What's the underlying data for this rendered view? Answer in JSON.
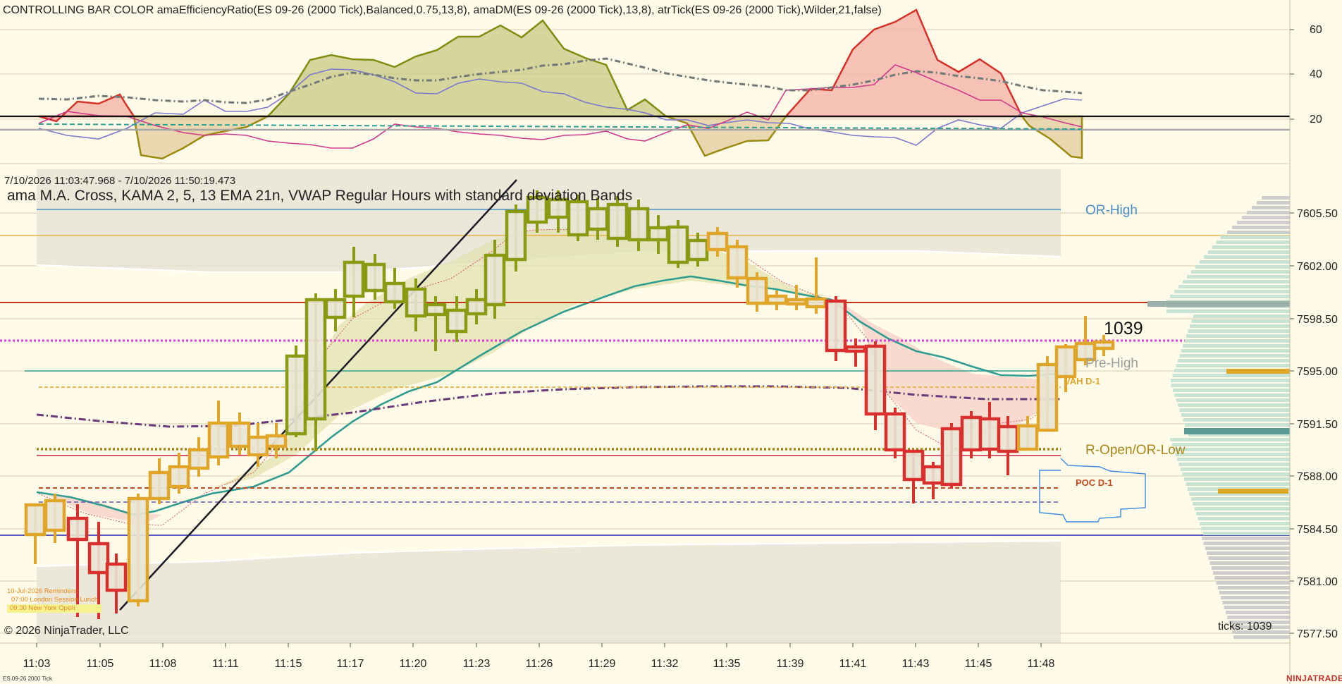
{
  "header": {
    "indicator_title": "CONTROLLING BAR COLOR amaEfficiencyRatio(ES 09-26 (2000 Tick),Balanced,0.75,13,8), amaDM(ES 09-26 (2000 Tick),13,8), atrTick(ES 09-26 (2000 Tick),Wilder,21,false)",
    "price_range_label": "7/10/2026 11:03:47.968 - 7/10/2026 11:50:19.473",
    "price_panel_title": "ama M.A. Cross,  KAMA  2, 5, 13 EMA 21n, VWAP Regular Hours with standard deviation Bands"
  },
  "colors": {
    "background": "#fffbe8",
    "bull": "#8a9a12",
    "bear": "#d9302e",
    "neutral": "#e0a62a",
    "ema": "#2f9c8f",
    "vwap": "#5a3a7a",
    "magenta": "#e23ad8",
    "or_high": "#4a8cc8",
    "pre_high": "#9aa0a0"
  },
  "indicator_axis_ticks": [
    "60",
    "40",
    "20"
  ],
  "price_axis_ticks": [
    "7605.50",
    "7602.00",
    "7598.50",
    "7595.00",
    "7591.50",
    "7588.00",
    "7584.50",
    "7581.00",
    "7577.50"
  ],
  "time_axis_ticks": [
    "11:03",
    "11:05",
    "11:08",
    "11:11",
    "11:15",
    "11:17",
    "11:20",
    "11:23",
    "11:26",
    "11:29",
    "11:32",
    "11:35",
    "11:39",
    "11:41",
    "11:43",
    "11:45",
    "11:48"
  ],
  "level_labels": {
    "or_high": "OR-High",
    "pre_high": "Pre-High",
    "vah": "VAH D-1",
    "r_open": "R-Open/OR-Low",
    "poc": "POC D-1"
  },
  "current_tick_count": "1039",
  "reminders": {
    "title": "10-Jul-2026 Reminders:",
    "line1": "07:00 London Session Lunch",
    "line2": "09:30 New York Open"
  },
  "footer": {
    "copyright": "© 2026 NinjaTrader, LLC",
    "ticks": "ticks: 1039",
    "instrument": "ES 09-26 2000 Tick",
    "brand": "NINJATRADER"
  }
}
